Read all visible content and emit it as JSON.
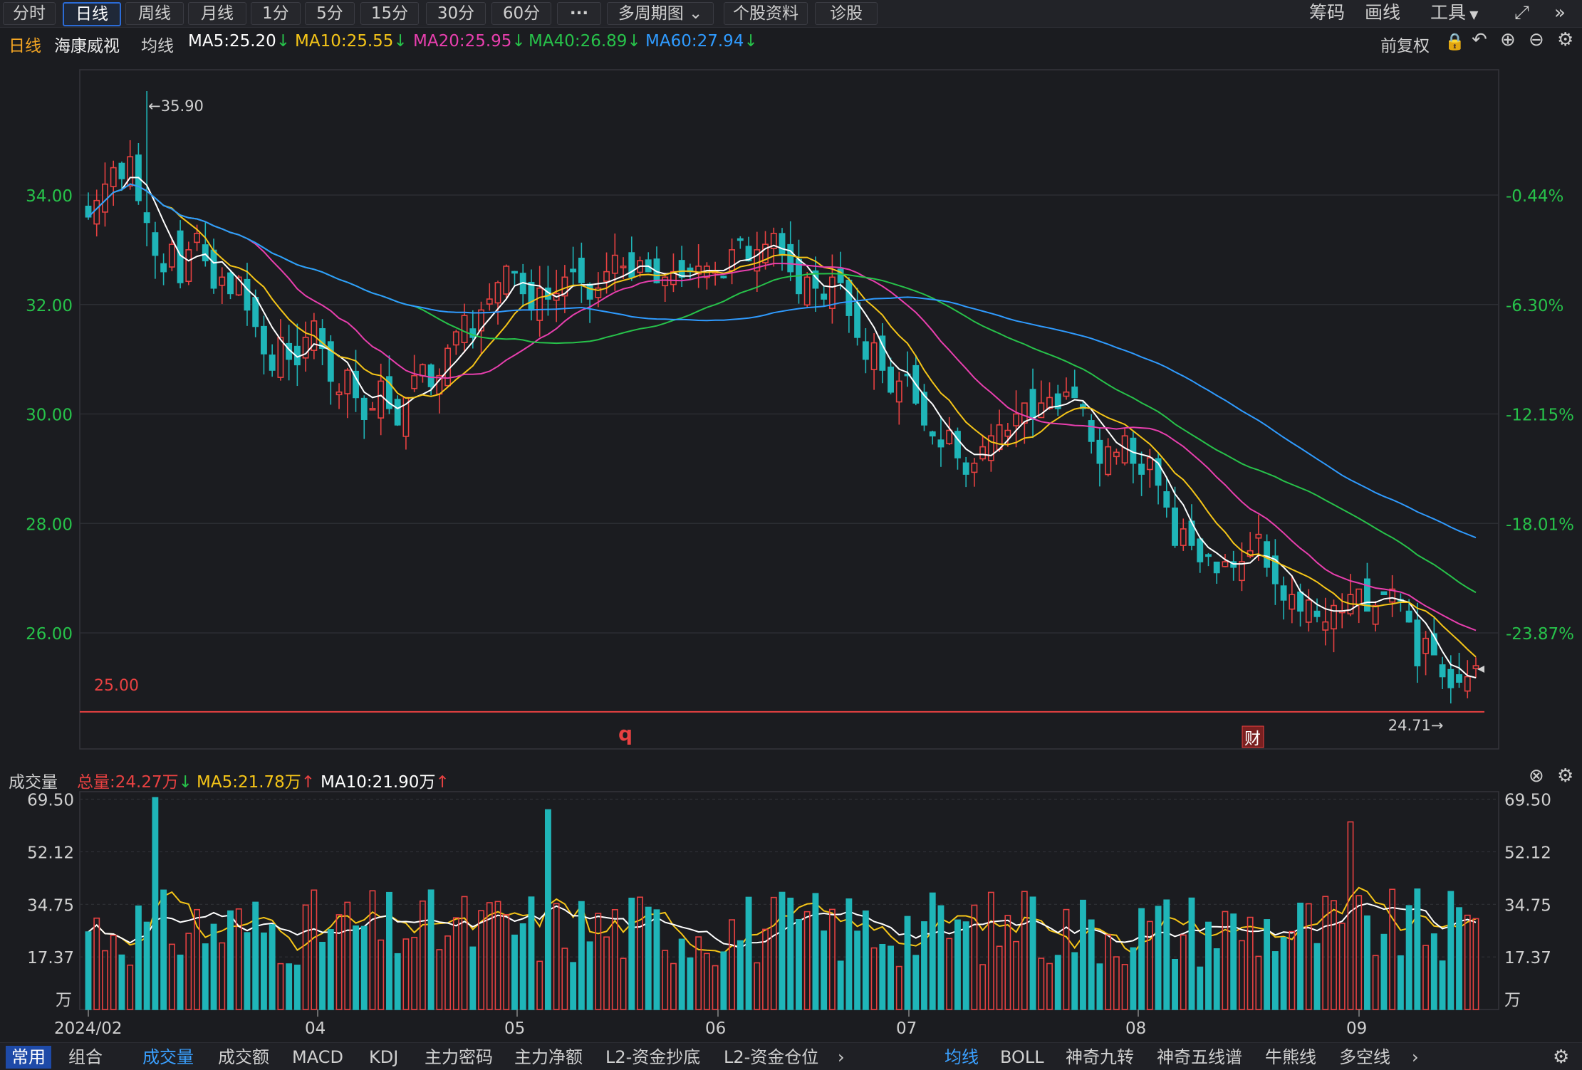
{
  "topbar": {
    "tabs": [
      "分时",
      "日线",
      "周线",
      "月线",
      "1分",
      "5分",
      "15分",
      "30分",
      "60分",
      "···"
    ],
    "active_tab": "日线",
    "multi_period": "多周期图",
    "stock_info": "个股资料",
    "diagnose": "诊股",
    "right_tools": [
      "筹码",
      "画线",
      "工具"
    ]
  },
  "header": {
    "period": "日线",
    "stock_name": "海康威视",
    "ma_label": "均线",
    "ma5": "MA5:25.20",
    "ma10": "MA10:25.55",
    "ma20": "MA20:25.95",
    "ma40": "MA40:26.89",
    "ma60": "MA60:27.94",
    "adjust": "前复权",
    "colors": {
      "ma5": "#ffffff",
      "ma10": "#f5c518",
      "ma20": "#e83fae",
      "ma40": "#27c24a",
      "ma60": "#2f9bff",
      "up": "#e84141",
      "down": "#1fb5b8"
    }
  },
  "price_axis": {
    "left_ticks": [
      "34.00",
      "32.00",
      "30.00",
      "28.00",
      "26.00"
    ],
    "right_ticks": [
      "-0.44%",
      "-6.30%",
      "-12.15%",
      "-18.01%",
      "-23.87%"
    ]
  },
  "annotations": {
    "high": "←35.90",
    "low": "24.71→",
    "line_level": "25.00",
    "marker_q": "q",
    "marker_cai": "财"
  },
  "volume_header": {
    "label": "成交量",
    "total": "总量:24.27万",
    "ma5": "MA5:21.78万",
    "ma10": "MA10:21.90万"
  },
  "volume_axis": {
    "ticks": [
      "69.50",
      "52.12",
      "34.75",
      "17.37"
    ],
    "unit": "万"
  },
  "x_axis": {
    "labels": [
      "2024/02",
      "04",
      "05",
      "06",
      "07",
      "08",
      "09"
    ]
  },
  "bottom_tabs": {
    "left": [
      "常用",
      "组合"
    ],
    "indicators": [
      "成交量",
      "成交额",
      "MACD",
      "KDJ",
      "主力密码",
      "主力净额",
      "L2-资金抄底",
      "L2-资金仓位"
    ],
    "right": [
      "均线",
      "BOLL",
      "神奇九转",
      "神奇五线谱",
      "牛熊线",
      "多空线"
    ]
  },
  "chart_data": {
    "type": "candlestick",
    "ylim": [
      24.2,
      36.6
    ],
    "volume_ylim": [
      0,
      72
    ],
    "closes": [
      33.6,
      33.9,
      34.2,
      34.5,
      34.3,
      34.7,
      33.9,
      33.5,
      32.9,
      32.6,
      33.1,
      32.4,
      33.0,
      33.3,
      32.8,
      32.3,
      32.5,
      32.2,
      32.5,
      31.9,
      31.6,
      31.1,
      30.8,
      31.4,
      31.0,
      30.9,
      31.4,
      31.7,
      31.2,
      30.6,
      30.4,
      30.8,
      30.3,
      29.9,
      30.1,
      30.6,
      30.1,
      29.8,
      30.3,
      30.7,
      30.9,
      30.5,
      30.7,
      31.2,
      31.5,
      31.8,
      31.4,
      31.9,
      32.1,
      32.4,
      32.7,
      32.6,
      32.2,
      31.9,
      32.3,
      32.1,
      32.2,
      32.5,
      32.6,
      32.4,
      32.1,
      32.3,
      32.6,
      32.9,
      32.7,
      32.5,
      32.8,
      32.6,
      32.4,
      32.5,
      32.6,
      32.5,
      32.6,
      32.7,
      32.7,
      32.6,
      32.5,
      33.0,
      33.2,
      32.8,
      33.0,
      33.1,
      33.3,
      32.9,
      32.6,
      32.2,
      32.5,
      32.3,
      32.1,
      32.5,
      32.4,
      31.8,
      31.4,
      31.0,
      31.3,
      30.8,
      30.4,
      30.6,
      30.7,
      30.2,
      29.8,
      29.6,
      29.4,
      29.7,
      29.2,
      28.9,
      29.1,
      29.4,
      29.6,
      29.8,
      29.7,
      30.0,
      30.2,
      29.9,
      30.2,
      30.3,
      30.1,
      30.4,
      30.3,
      30.1,
      29.5,
      29.1,
      29.4,
      29.3,
      29.6,
      29.1,
      28.9,
      29.2,
      28.7,
      28.3,
      27.6,
      27.9,
      27.6,
      27.3,
      27.4,
      27.1,
      27.3,
      27.2,
      27.3,
      27.5,
      27.8,
      27.2,
      26.9,
      26.6,
      26.7,
      26.4,
      26.6,
      26.3,
      26.2,
      26.5,
      26.4,
      26.7,
      26.8,
      26.4,
      26.5,
      26.7,
      26.8,
      26.6,
      26.2,
      25.4,
      25.9,
      25.6,
      25.2,
      25.0,
      25.1,
      25.2,
      25.4
    ],
    "x_labels": [
      "2024/02",
      "04",
      "05",
      "06",
      "07",
      "08",
      "09"
    ]
  }
}
